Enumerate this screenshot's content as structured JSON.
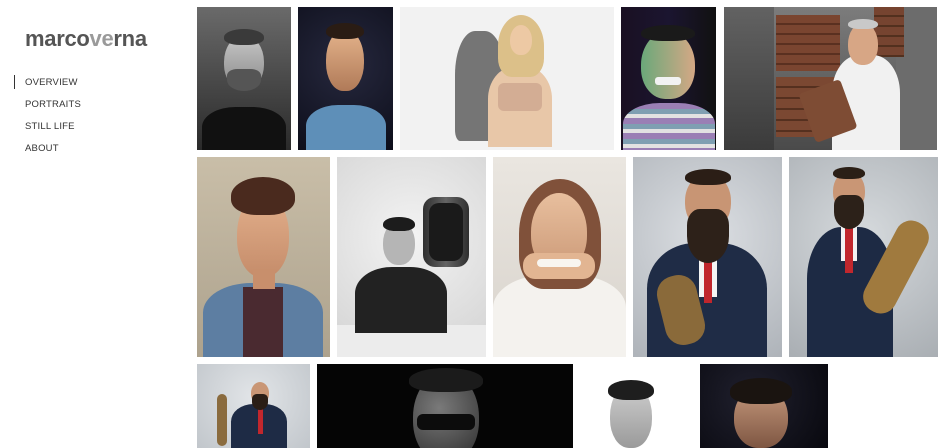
{
  "site": {
    "logo_part_a": "marco",
    "logo_part_b": "ve",
    "logo_part_c": "rna"
  },
  "nav": {
    "items": [
      {
        "label": "OVERVIEW",
        "active": true
      },
      {
        "label": "PORTRAITS",
        "active": false
      },
      {
        "label": "STILL LIFE",
        "active": false
      },
      {
        "label": "ABOUT",
        "active": false
      }
    ]
  },
  "gallery": {
    "rows": 3,
    "photos": [
      {
        "subject": "man-bw-portrait"
      },
      {
        "subject": "man-blue-shirt-dark-bg"
      },
      {
        "subject": "woman-blonde-white-bg"
      },
      {
        "subject": "man-grimace-green-light"
      },
      {
        "subject": "man-lab-coat-safe"
      },
      {
        "subject": "young-man-denim-jacket"
      },
      {
        "subject": "man-with-drum-bw"
      },
      {
        "subject": "woman-white-sweater"
      },
      {
        "subject": "bearded-man-skateboard"
      },
      {
        "subject": "bearded-man-skateboard-2"
      },
      {
        "subject": "bearded-man-small"
      },
      {
        "subject": "man-sunglasses-bw"
      },
      {
        "subject": "man-bw-white-bg"
      },
      {
        "subject": "man-dark-portrait"
      }
    ]
  },
  "colors": {
    "logo_dark": "#555555",
    "logo_light": "#9a9a9a",
    "nav_text": "#333333"
  }
}
